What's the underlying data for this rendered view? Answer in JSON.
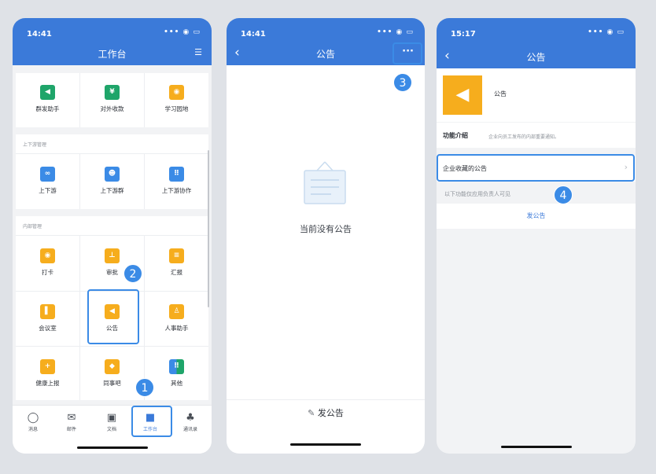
{
  "phone1": {
    "time": "14:41",
    "title": "工作台",
    "top_row": [
      "群发助手",
      "对外收款",
      "学习园地"
    ],
    "section_updown": "上下游管理",
    "updown_items": [
      "上下游",
      "上下游群",
      "上下游协作"
    ],
    "section_internal": "内部管理",
    "internal_items": [
      "打卡",
      "审批",
      "汇报",
      "会议室",
      "公告",
      "人事助手",
      "健康上报",
      "同事吧",
      "其他"
    ],
    "tabs": [
      "消息",
      "邮件",
      "文档",
      "工作台",
      "通讯录"
    ],
    "badges": [
      "1",
      "2"
    ]
  },
  "phone2": {
    "time": "14:41",
    "title": "公告",
    "empty_text": "当前没有公告",
    "bottom_button": "发公告",
    "badge": "3"
  },
  "phone3": {
    "time": "15:17",
    "title": "公告",
    "app_name": "公告",
    "intro_label": "功能介绍",
    "intro_text": "企业向员工发布的内部重要通知。",
    "favorite_row": "企业收藏的公告",
    "note": "以下功能仅应用负责人可见",
    "publish": "发公告",
    "badge": "4"
  },
  "colors": {
    "header": "#3b7ad9",
    "highlight": "#3b8be6",
    "orange": "#f6ad1d",
    "green": "#1fa56a",
    "blue": "#3b8be6"
  }
}
